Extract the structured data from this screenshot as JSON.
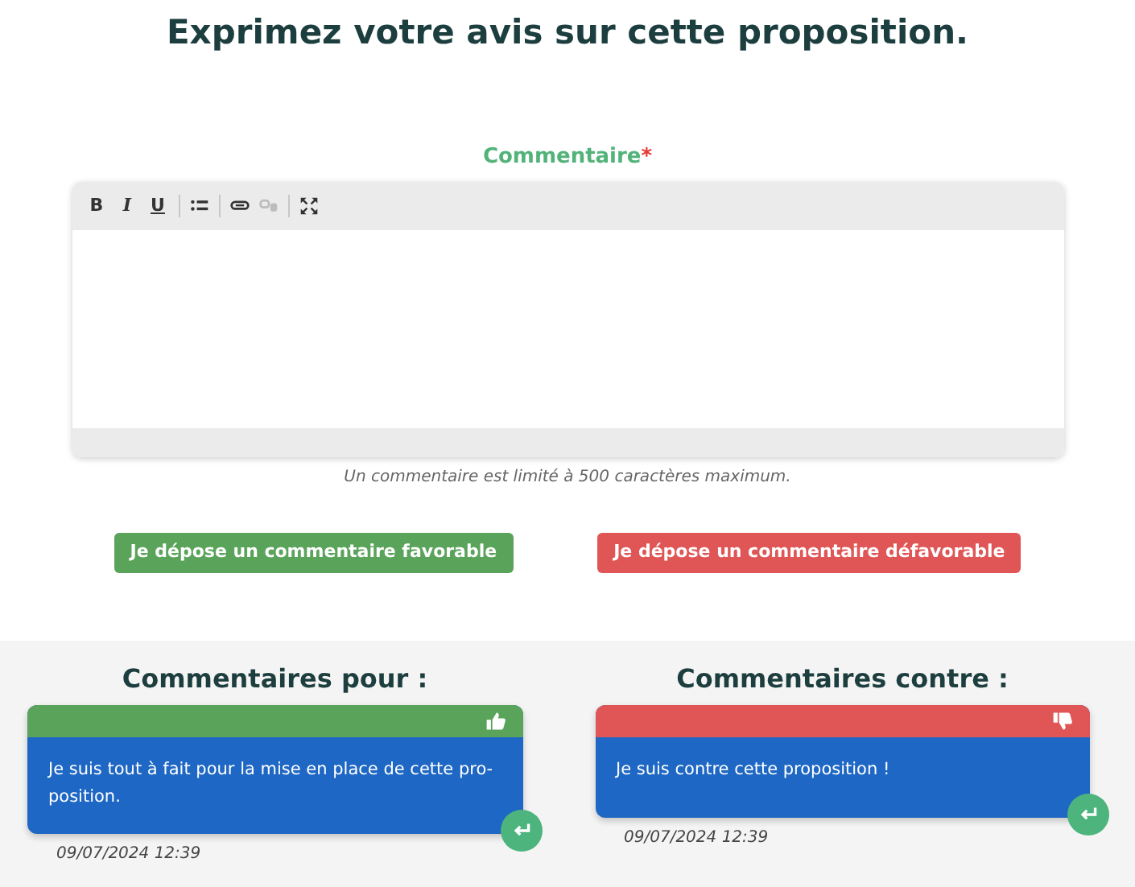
{
  "title": "Exprimez votre avis sur cette proposition.",
  "editor": {
    "label": "Commentaire",
    "required_mark": "*",
    "toolbar": [
      {
        "kind": "text",
        "label": "B",
        "disabled": false
      },
      {
        "kind": "text",
        "label": "I",
        "disabled": false
      },
      {
        "kind": "text",
        "label": "U",
        "disabled": false
      },
      {
        "kind": "separator"
      },
      {
        "kind": "list",
        "disabled": false
      },
      {
        "kind": "separator"
      },
      {
        "kind": "link",
        "disabled": false
      },
      {
        "kind": "unlink",
        "disabled": true
      },
      {
        "kind": "separator"
      },
      {
        "kind": "fullscreen",
        "disabled": false
      }
    ],
    "hint": "Un commentaire est limité à 500 caractères maximum."
  },
  "buttons": [
    {
      "kind": "favorable",
      "label": "Je dépose un commentaire favorable"
    },
    {
      "kind": "defavorable",
      "label": "Je dépose un commentaire défavorable"
    }
  ],
  "columns": [
    {
      "kind": "favorable",
      "heading": "Commentaires pour :",
      "comments": [
        {
          "text": "Je suis tout à fait pour la mise en place de cette pro-position.",
          "date": "09/07/2024 12:39"
        }
      ]
    },
    {
      "kind": "defavorable",
      "heading": "Commentaires contre :",
      "comments": [
        {
          "text": "Je suis contre cette proposition !",
          "date": "09/07/2024 12:39"
        }
      ]
    }
  ]
}
